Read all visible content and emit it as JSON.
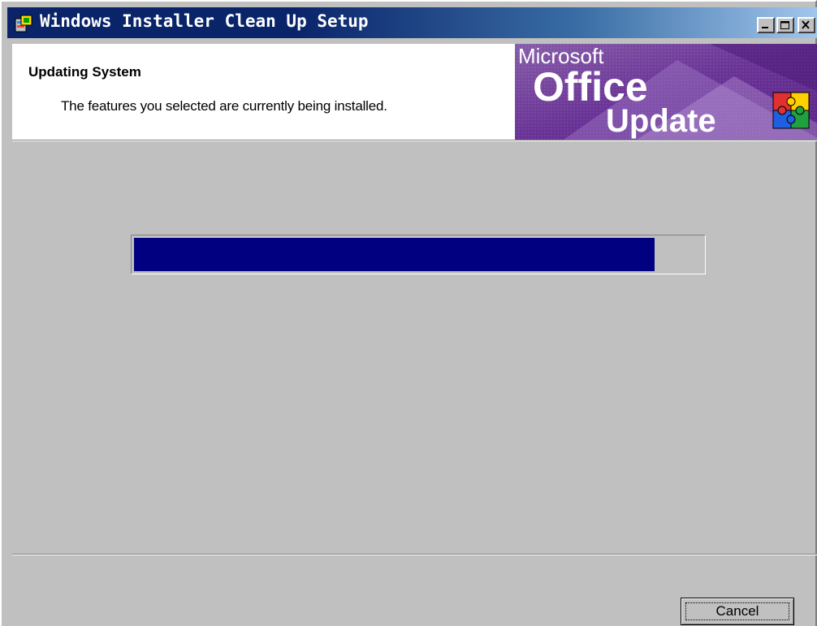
{
  "window": {
    "title": "Windows Installer Clean Up Setup",
    "title_bar_buttons": [
      "minimize",
      "maximize",
      "close"
    ]
  },
  "header": {
    "title": "Updating System",
    "subtitle": "The features you selected are currently being installed.",
    "banner": {
      "line1": "Microsoft",
      "line2": "Office",
      "line3": "Update",
      "icon": "puzzle-icon"
    }
  },
  "progress": {
    "fraction": 0.915,
    "color": "#000080"
  },
  "buttons": {
    "cancel_label": "Cancel"
  },
  "colors": {
    "title_bar": "#0a246a",
    "dialog_face": "#c0c0c0",
    "banner_purple": "#6a2c8a"
  }
}
